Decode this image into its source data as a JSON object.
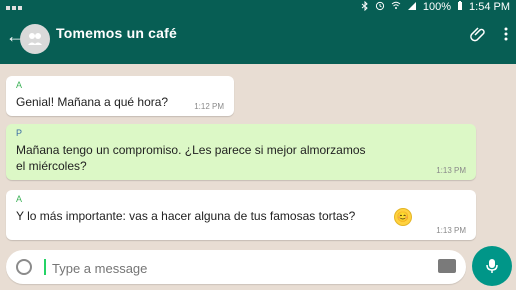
{
  "statusbar": {
    "battery": "100%",
    "time": "1:54 PM"
  },
  "toolbar": {
    "title": "Tomemos un café",
    "back_icon": "arrow-left",
    "attach_icon": "paperclip",
    "menu_icon": "kebab-menu"
  },
  "messages": [
    {
      "sender": "A",
      "text": "Genial! Mañana a qué hora?",
      "time": "1:12 PM",
      "type": "incoming"
    },
    {
      "sender": "P",
      "text": "Mañana tengo un compromiso. ¿Les parece si mejor almorzamos el miércoles?",
      "time": "1:13 PM",
      "type": "outgoing"
    },
    {
      "sender": "A",
      "text": "Y lo más importante: vas a hacer alguna de tus famosas tortas?",
      "time": "1:13 PM",
      "type": "incoming",
      "emoji": "😊"
    }
  ],
  "input": {
    "placeholder": "Type a message"
  },
  "colors": {
    "header": "#075e54",
    "bubble_in": "#ffffff",
    "bubble_out": "#dcf8c6",
    "mic": "#009688"
  }
}
